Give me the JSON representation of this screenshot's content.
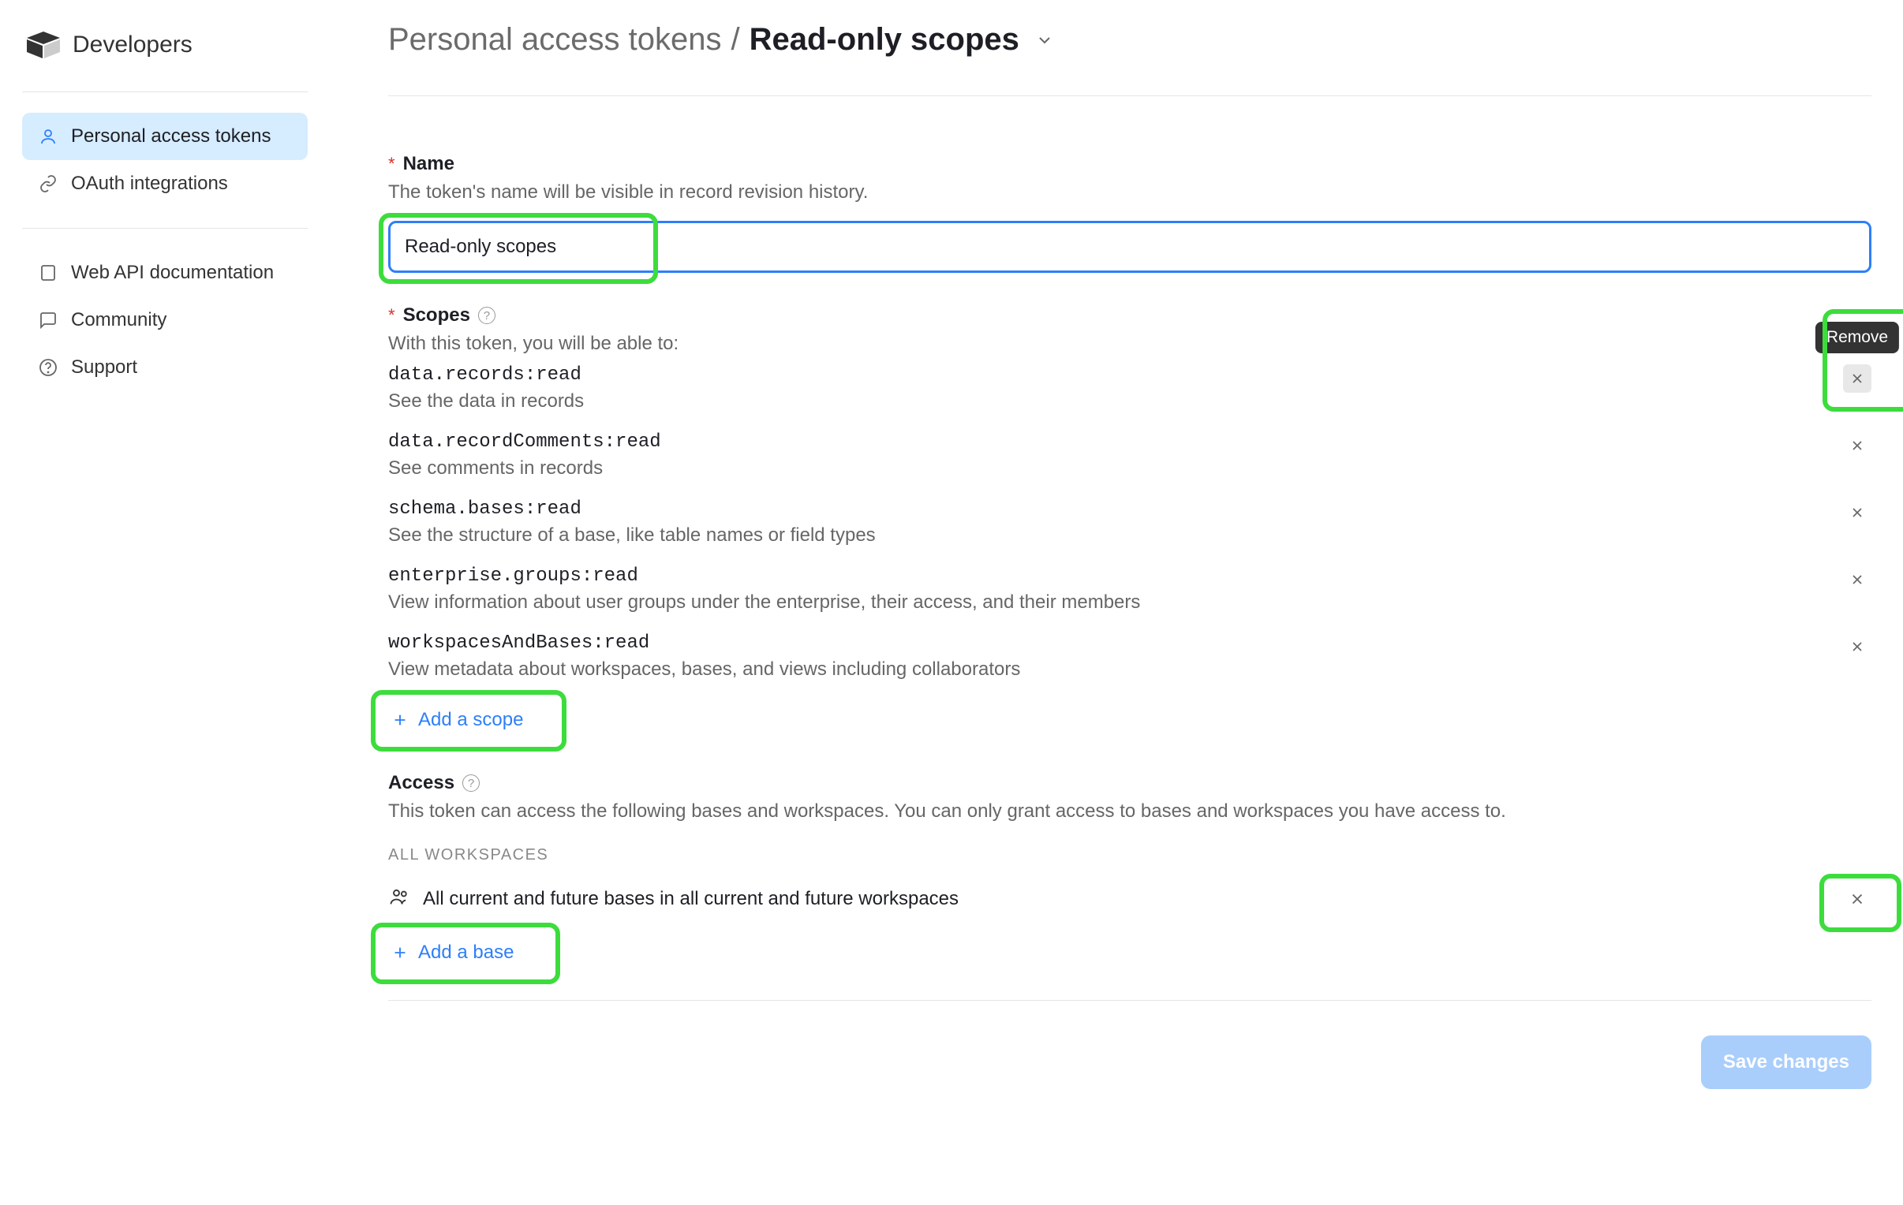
{
  "logo": {
    "text": "Developers"
  },
  "sidebar": {
    "group1": [
      {
        "label": "Personal access tokens",
        "active": true
      },
      {
        "label": "OAuth integrations",
        "active": false
      }
    ],
    "group2": [
      {
        "label": "Web API documentation"
      },
      {
        "label": "Community"
      },
      {
        "label": "Support"
      }
    ]
  },
  "breadcrumb": {
    "parent": "Personal access tokens",
    "sep": "/",
    "current": "Read-only scopes"
  },
  "form": {
    "name": {
      "label": "Name",
      "help": "The token's name will be visible in record revision history.",
      "value": "Read-only scopes"
    },
    "scopes": {
      "label": "Scopes",
      "help": "With this token, you will be able to:",
      "items": [
        {
          "code": "data.records:read",
          "desc": "See the data in records",
          "hovered": true
        },
        {
          "code": "data.recordComments:read",
          "desc": "See comments in records"
        },
        {
          "code": "schema.bases:read",
          "desc": "See the structure of a base, like table names or field types"
        },
        {
          "code": "enterprise.groups:read",
          "desc": "View information about user groups under the enterprise, their access, and their members"
        },
        {
          "code": "workspacesAndBases:read",
          "desc": "View metadata about workspaces, bases, and views including collaborators"
        }
      ],
      "add_label": "Add a scope",
      "remove_tooltip": "Remove"
    },
    "access": {
      "label": "Access",
      "help": "This token can access the following bases and workspaces. You can only grant access to bases and workspaces you have access to.",
      "subhead": "ALL WORKSPACES",
      "row_text": "All current and future bases in all current and future workspaces",
      "add_label": "Add a base"
    }
  },
  "footer": {
    "save_label": "Save changes"
  }
}
